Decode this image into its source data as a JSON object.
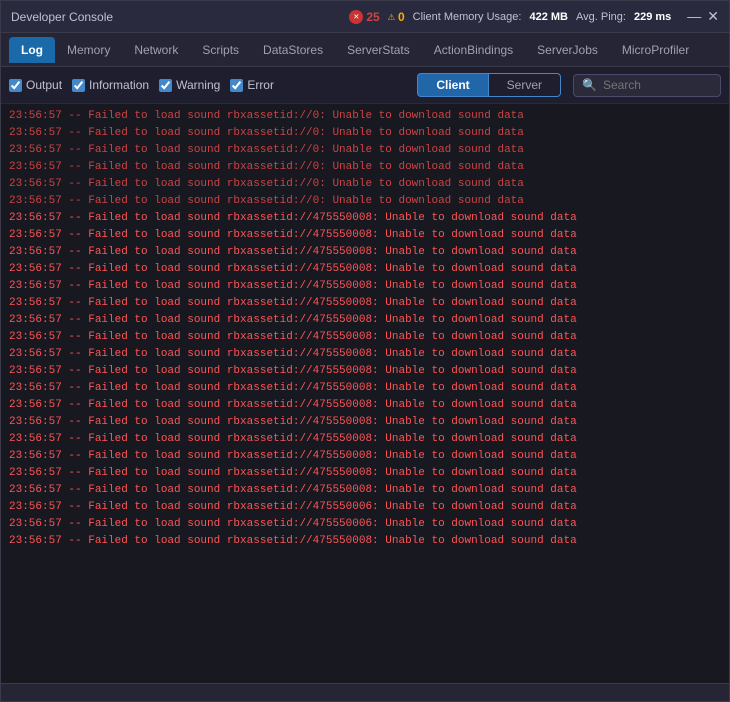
{
  "titleBar": {
    "title": "Developer Console",
    "errorCount": "25",
    "warnCount": "0",
    "memoryLabel": "Client Memory Usage:",
    "memoryValue": "422 MB",
    "pingLabel": "Avg. Ping:",
    "pingValue": "229 ms",
    "minimizeBtn": "—",
    "closeBtn": "✕"
  },
  "navTabs": [
    {
      "label": "Log",
      "active": true
    },
    {
      "label": "Memory",
      "active": false
    },
    {
      "label": "Network",
      "active": false
    },
    {
      "label": "Scripts",
      "active": false
    },
    {
      "label": "DataStores",
      "active": false
    },
    {
      "label": "ServerStats",
      "active": false
    },
    {
      "label": "ActionBindings",
      "active": false
    },
    {
      "label": "ServerJobs",
      "active": false
    },
    {
      "label": "MicroProfiler",
      "active": false
    }
  ],
  "toolbar": {
    "outputLabel": "Output",
    "informationLabel": "Information",
    "warningLabel": "Warning",
    "errorLabel": "Error",
    "clientBtn": "Client",
    "serverBtn": "Server",
    "searchPlaceholder": "Search"
  },
  "logLines": [
    {
      "text": "23:56:57  --  Failed to load sound rbxassetid://0: Unable to download sound data",
      "type": "error-normal"
    },
    {
      "text": "23:56:57  --  Failed to load sound rbxassetid://0: Unable to download sound data",
      "type": "error-normal"
    },
    {
      "text": "23:56:57  --  Failed to load sound rbxassetid://0: Unable to download sound data",
      "type": "error-normal"
    },
    {
      "text": "23:56:57  --  Failed to load sound rbxassetid://0: Unable to download sound data",
      "type": "error-normal"
    },
    {
      "text": "23:56:57  --  Failed to load sound rbxassetid://0: Unable to download sound data",
      "type": "error-normal"
    },
    {
      "text": "23:56:57  --  Failed to load sound rbxassetid://0: Unable to download sound data",
      "type": "error-normal"
    },
    {
      "text": "23:56:57  --  Failed to load sound rbxassetid://475550008: Unable to download sound data",
      "type": "error-bright"
    },
    {
      "text": "23:56:57  --  Failed to load sound rbxassetid://475550008: Unable to download sound data",
      "type": "error-bright"
    },
    {
      "text": "23:56:57  --  Failed to load sound rbxassetid://475550008: Unable to download sound data",
      "type": "error-bright"
    },
    {
      "text": "23:56:57  --  Failed to load sound rbxassetid://475550008: Unable to download sound data",
      "type": "error-bright"
    },
    {
      "text": "23:56:57  --  Failed to load sound rbxassetid://475550008: Unable to download sound data",
      "type": "error-bright"
    },
    {
      "text": "23:56:57  --  Failed to load sound rbxassetid://475550008: Unable to download sound data",
      "type": "error-bright"
    },
    {
      "text": "23:56:57  --  Failed to load sound rbxassetid://475550008: Unable to download sound data",
      "type": "error-bright"
    },
    {
      "text": "23:56:57  --  Failed to load sound rbxassetid://475550008: Unable to download sound data",
      "type": "error-bright"
    },
    {
      "text": "23:56:57  --  Failed to load sound rbxassetid://475550008: Unable to download sound data",
      "type": "error-bright"
    },
    {
      "text": "23:56:57  --  Failed to load sound rbxassetid://475550008: Unable to download sound data",
      "type": "error-bright"
    },
    {
      "text": "23:56:57  --  Failed to load sound rbxassetid://475550008: Unable to download sound data",
      "type": "error-bright"
    },
    {
      "text": "23:56:57  --  Failed to load sound rbxassetid://475550008: Unable to download sound data",
      "type": "error-bright"
    },
    {
      "text": "23:56:57  --  Failed to load sound rbxassetid://475550008: Unable to download sound data",
      "type": "error-bright"
    },
    {
      "text": "23:56:57  --  Failed to load sound rbxassetid://475550008: Unable to download sound data",
      "type": "error-bright"
    },
    {
      "text": "23:56:57  --  Failed to load sound rbxassetid://475550008: Unable to download sound data",
      "type": "error-bright"
    },
    {
      "text": "23:56:57  --  Failed to load sound rbxassetid://475550008: Unable to download sound data",
      "type": "error-bright"
    },
    {
      "text": "23:56:57  --  Failed to load sound rbxassetid://475550008: Unable to download sound data",
      "type": "error-bright"
    },
    {
      "text": "23:56:57  --  Failed to load sound rbxassetid://475550006: Unable to download sound data",
      "type": "error-bright"
    },
    {
      "text": "23:56:57  --  Failed to load sound rbxassetid://475550006: Unable to download sound data",
      "type": "error-bright"
    },
    {
      "text": "23:56:57  --  Failed to load sound rbxassetid://475550008: Unable to download sound data",
      "type": "error-bright"
    }
  ]
}
